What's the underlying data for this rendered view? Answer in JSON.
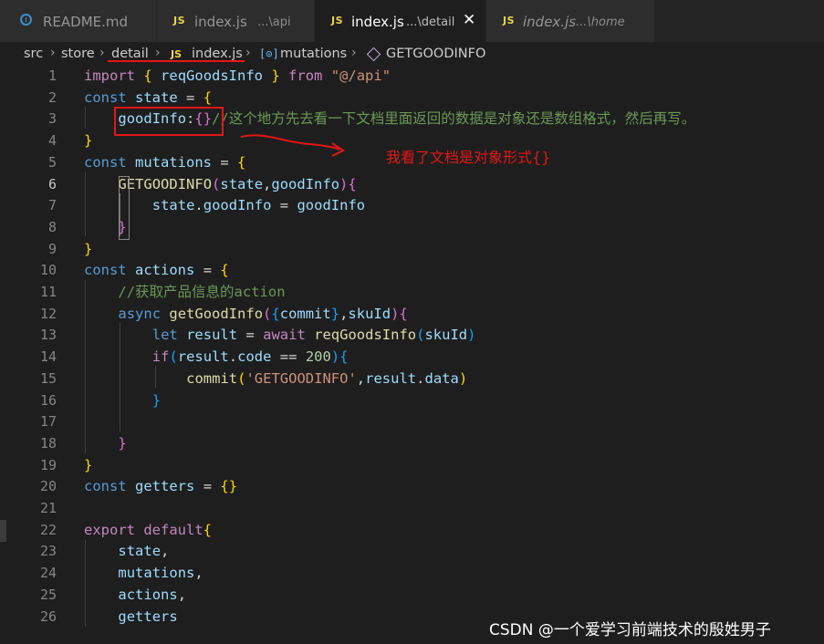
{
  "tabs": [
    {
      "label": "README.md",
      "path": "",
      "icon": "info-icon",
      "italic": false,
      "active": false
    },
    {
      "label": "index.js",
      "path": "...\\api",
      "icon": "js-icon",
      "italic": false,
      "active": false
    },
    {
      "label": "index.js",
      "path": "...\\detail",
      "icon": "js-icon",
      "italic": false,
      "active": true
    },
    {
      "label": "index.js",
      "path": "...\\home",
      "icon": "js-icon",
      "italic": true,
      "active": false
    }
  ],
  "js_badge": "JS",
  "close_glyph": "✕",
  "breadcrumb": {
    "src": "src",
    "store": "store",
    "detail": "detail",
    "file": "index.js",
    "mutations": "mutations",
    "item": "GETGOODINFO",
    "separator": "›"
  },
  "line_numbers": [
    "1",
    "2",
    "3",
    "4",
    "5",
    "6",
    "7",
    "8",
    "9",
    "10",
    "11",
    "12",
    "13",
    "14",
    "15",
    "16",
    "17",
    "18",
    "19",
    "20",
    "21",
    "22",
    "23",
    "24",
    "25",
    "26"
  ],
  "active_line": "6",
  "code_lines": [
    "import { reqGoodsInfo } from \"@/api\"",
    "const state = {",
    "    goodInfo:{}//这个地方先去看一下文档里面返回的数据是对象还是数组格式，然后再写。",
    "}",
    "const mutations = {",
    "    GETGOODINFO(state,goodInfo){",
    "        state.goodInfo = goodInfo",
    "    }",
    "}",
    "const actions = {",
    "    //获取产品信息的action",
    "    async getGoodInfo({commit},skuId){",
    "        let result = await reqGoodsInfo(skuId)",
    "        if(result.code == 200){",
    "            commit('GETGOODINFO',result.data)",
    "        }",
    "",
    "    }",
    "}",
    "const getters = {}",
    "",
    "export default{",
    "    state,",
    "    mutations,",
    "    actions,",
    "    getters"
  ],
  "annotation": "我看了文档是对象形式{}",
  "watermark": "CSDN @一个爱学习前端技术的殷姓男子",
  "colors": {
    "background": "#1e1e1e",
    "annotation_red": "#e51515",
    "keyword": "#569cd6",
    "variable": "#9cdcfe",
    "function": "#dcdcaa",
    "string": "#ce9178",
    "comment": "#6a9955"
  }
}
